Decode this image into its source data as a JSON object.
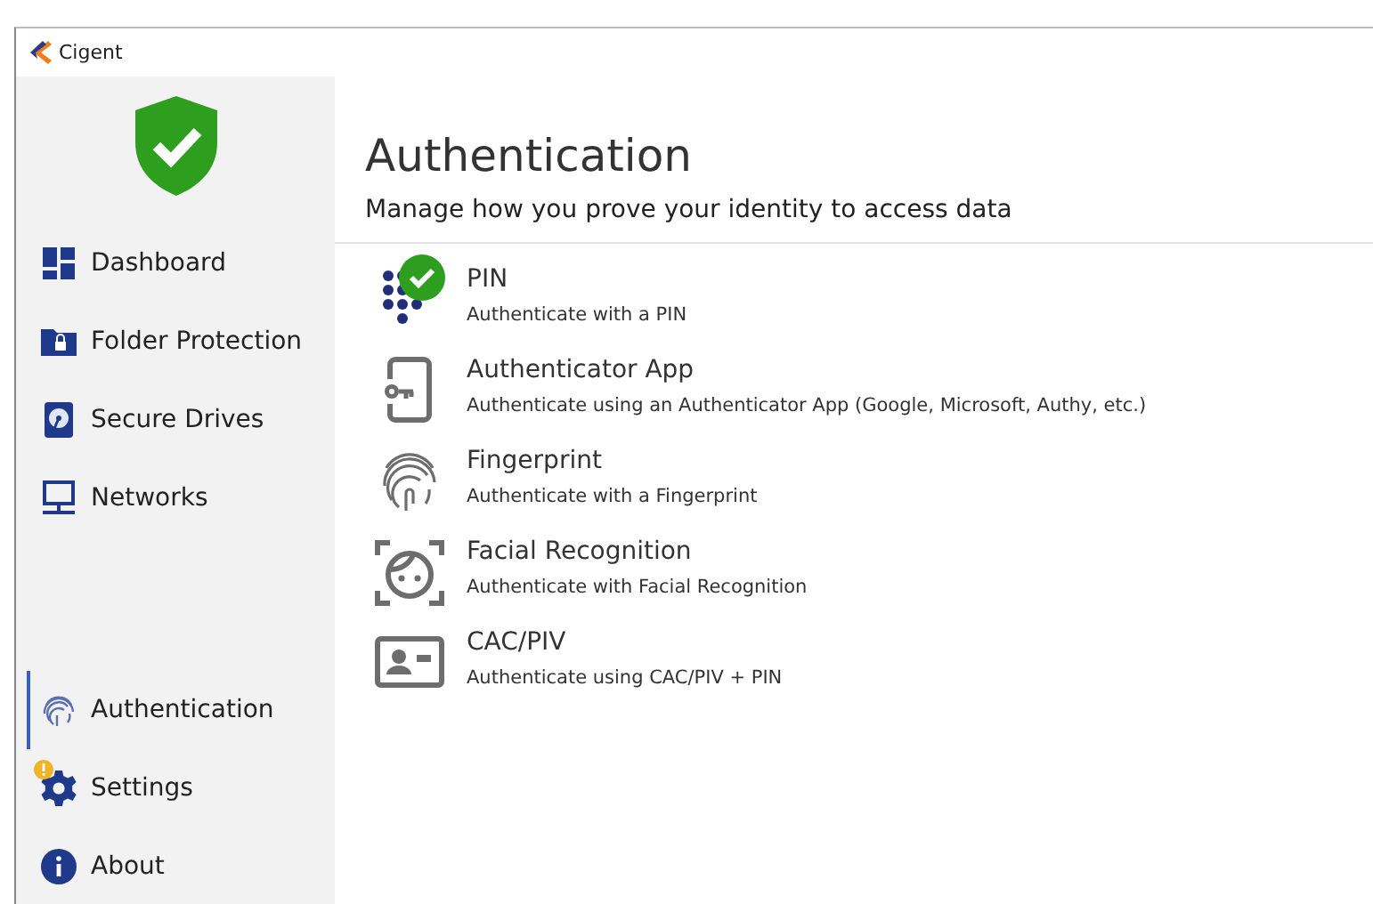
{
  "window": {
    "title": "Cigent"
  },
  "sidebar": {
    "status_verified": true,
    "items": [
      {
        "kind": "dashboard",
        "label": "Dashboard",
        "selected": false,
        "warning": false
      },
      {
        "kind": "folder",
        "label": "Folder Protection",
        "selected": false,
        "warning": false
      },
      {
        "kind": "drive",
        "label": "Secure Drives",
        "selected": false,
        "warning": false
      },
      {
        "kind": "network",
        "label": "Networks",
        "selected": false,
        "warning": false
      },
      {
        "kind": "gap"
      },
      {
        "kind": "fingerprint",
        "label": "Authentication",
        "selected": true,
        "warning": false
      },
      {
        "kind": "gear",
        "label": "Settings",
        "selected": false,
        "warning": true
      },
      {
        "kind": "info",
        "label": "About",
        "selected": false,
        "warning": false
      }
    ]
  },
  "page": {
    "title": "Authentication",
    "subtitle": "Manage how you prove your identity to access data"
  },
  "methods": [
    {
      "kind": "pin",
      "name": "PIN",
      "description": "Authenticate with a PIN",
      "enabled": true
    },
    {
      "kind": "app",
      "name": "Authenticator App",
      "description": "Authenticate using an Authenticator App (Google, Microsoft, Authy, etc.)",
      "enabled": false
    },
    {
      "kind": "fingerprint",
      "name": "Fingerprint",
      "description": "Authenticate with a Fingerprint",
      "enabled": false
    },
    {
      "kind": "face",
      "name": "Facial Recognition",
      "description": "Authenticate with Facial Recognition",
      "enabled": false
    },
    {
      "kind": "card",
      "name": "CAC/PIV",
      "description": "Authenticate using CAC/PIV + PIN",
      "enabled": false
    }
  ]
}
